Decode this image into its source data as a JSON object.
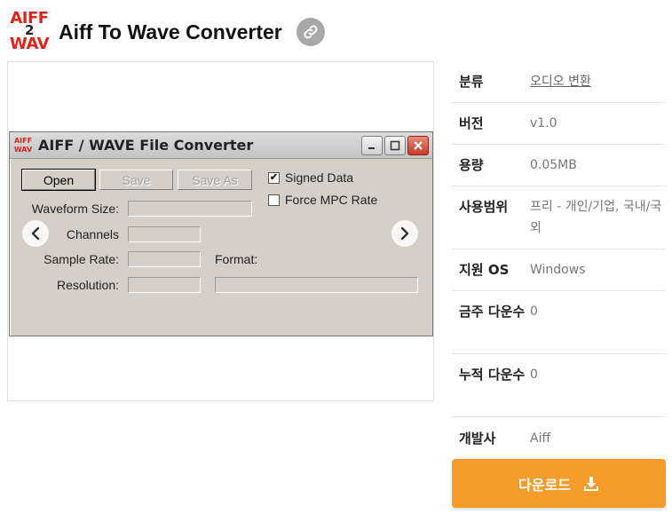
{
  "header": {
    "logo_top": "AIFF",
    "logo_mid": "2",
    "logo_bottom": "WAV",
    "title": "Aiff To Wave Converter",
    "link_icon": "link-icon"
  },
  "window": {
    "title": "AIFF / WAVE File Converter",
    "icon_top": "AIFF",
    "icon_bottom": "WAV",
    "buttons": {
      "open": "Open",
      "save": "Save",
      "save_as": "Save As"
    },
    "checkboxes": {
      "signed_data": {
        "label": "Signed Data",
        "checked": true
      },
      "force_mpc_rate": {
        "label": "Force MPC Rate",
        "checked": false
      }
    },
    "labels": {
      "waveform_size": "Waveform Size:",
      "channels": "Channels",
      "sample_rate": "Sample Rate:",
      "resolution": "Resolution:",
      "format": "Format:"
    },
    "checkmark": "✔"
  },
  "info": {
    "category": {
      "label": "분류",
      "value": "오디오 변환"
    },
    "version": {
      "label": "버전",
      "value": "v1.0"
    },
    "size": {
      "label": "용량",
      "value": "0.05MB"
    },
    "license": {
      "label": "사용범위",
      "value": "프리 - 개인/기업, 국내/국외"
    },
    "os": {
      "label": "지원 OS",
      "value": "Windows"
    },
    "weekly": {
      "label": "금주 다운수",
      "value": "0"
    },
    "total": {
      "label": "누적 다운수",
      "value": "0"
    },
    "developer": {
      "label": "개발사",
      "value": "Aiff"
    }
  },
  "download": {
    "label": "다운로드"
  },
  "colors": {
    "accent": "#f59c2a",
    "logo_red": "#e0231b"
  }
}
